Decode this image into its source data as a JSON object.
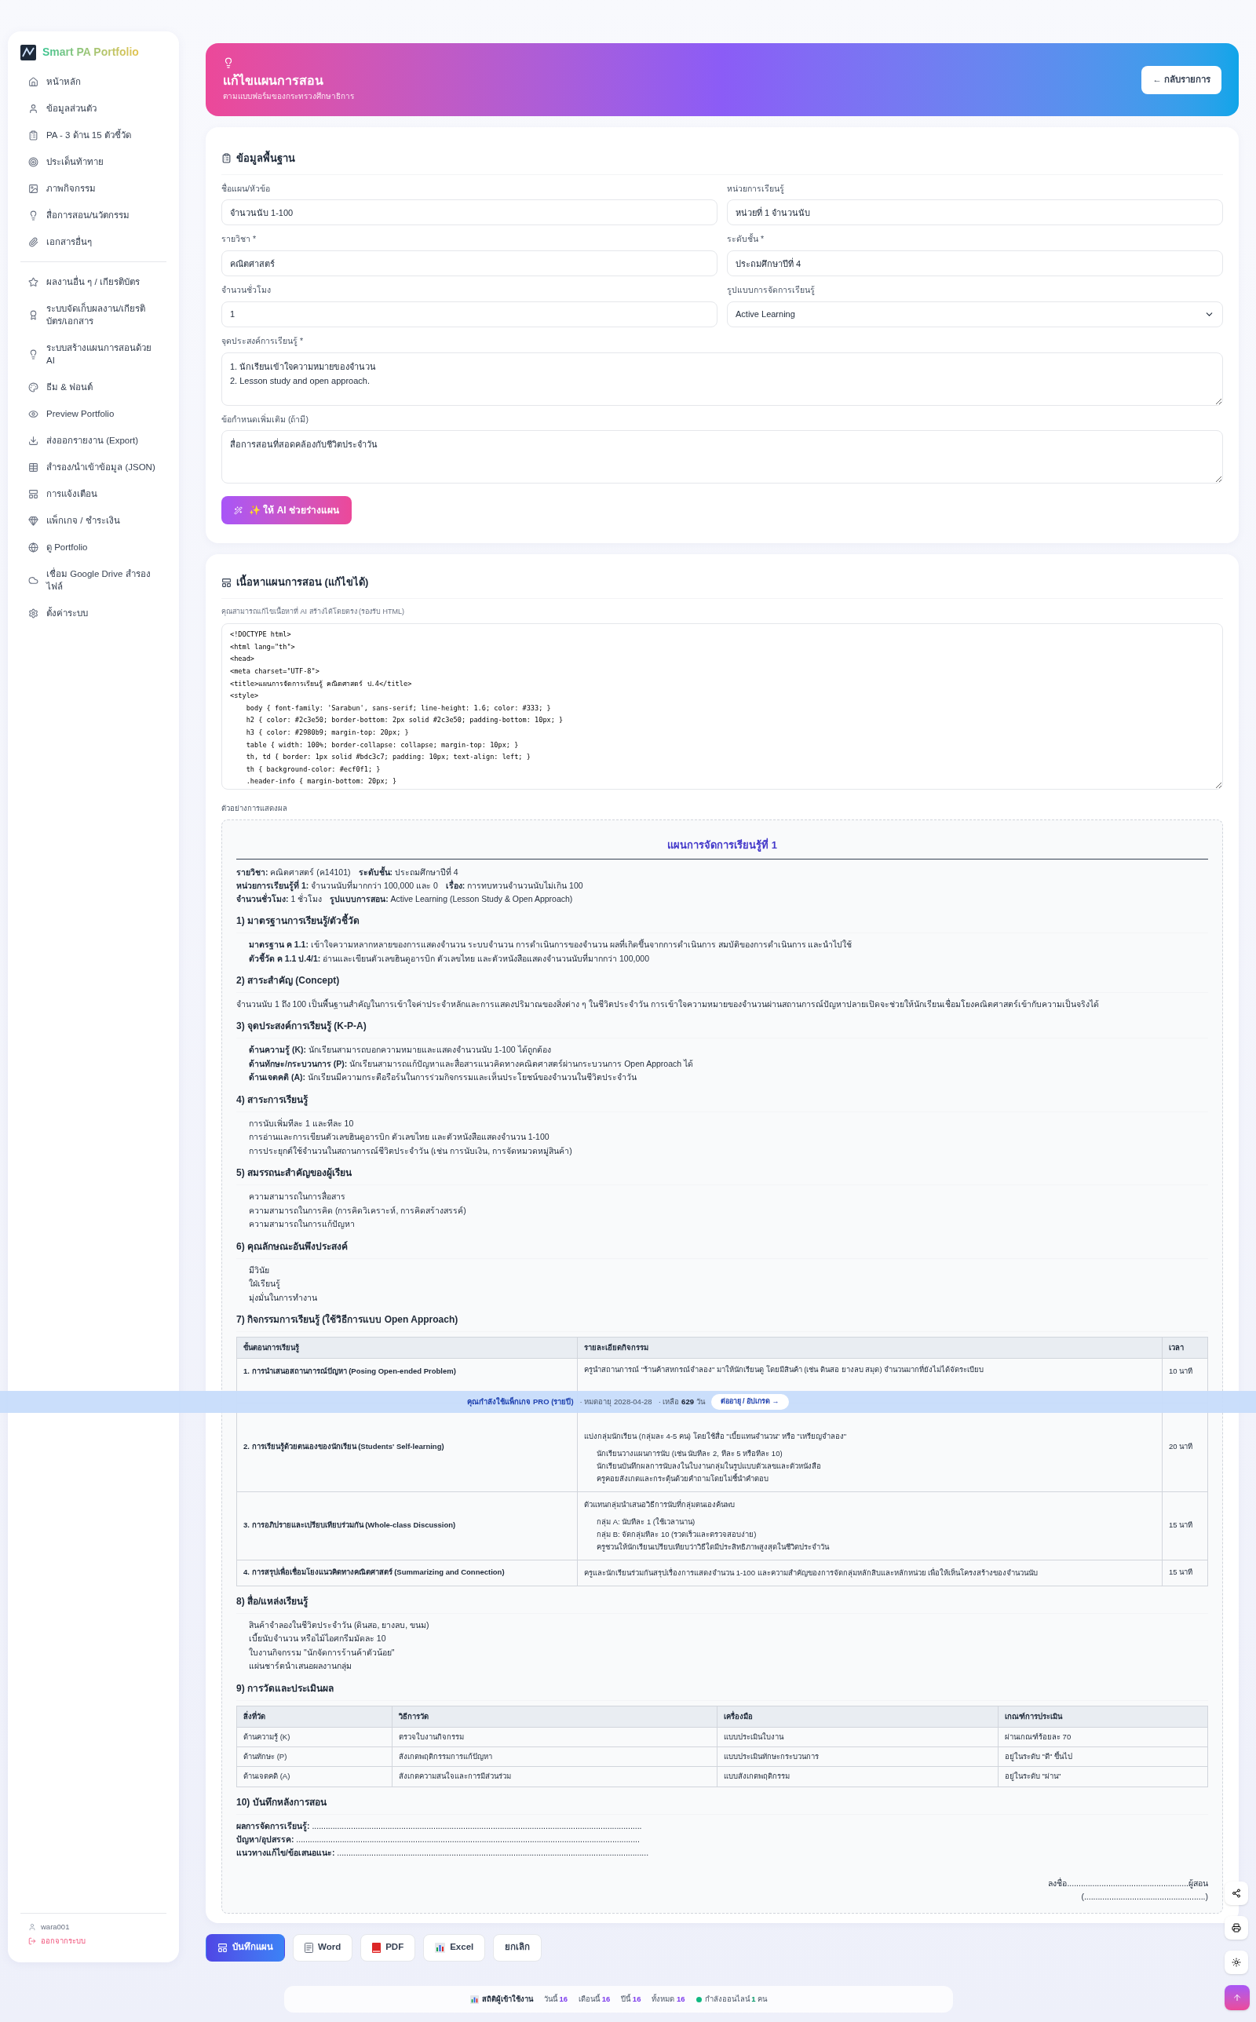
{
  "sidebar": {
    "brand": "Smart PA Portfolio",
    "groups": [
      [
        "หน้าหลัก",
        "ข้อมูลส่วนตัว",
        "PA - 3 ด้าน 15 ตัวชี้วัด",
        "ประเด็นท้าทาย",
        "ภาพกิจกรรม",
        "สื่อการสอน/นวัตกรรม",
        "เอกสารอื่นๆ"
      ],
      [
        "ผลงานอื่น ๆ / เกียรติบัตร",
        "ระบบจัดเก็บผลงาน/เกียรติบัตร/เอกสาร",
        "ระบบสร้างแผนการสอนด้วย AI",
        "ธีม & ฟอนต์",
        "Preview Portfolio",
        "ส่งออกรายงาน (Export)",
        "สำรอง/นำเข้าข้อมูล (JSON)",
        "การแจ้งเตือน",
        "แพ็กเกจ / ชำระเงิน",
        "ดู Portfolio",
        "เชื่อม Google Drive สำรองไฟล์",
        "ตั้งค่าระบบ"
      ]
    ],
    "user": "wara001",
    "logout": "ออกจากระบบ"
  },
  "header": {
    "title": "แก้ไขแผนการสอน",
    "subtitle": "ตามแบบฟอร์มของกระทรวงศึกษาธิการ",
    "back_button": "← กลับรายการ"
  },
  "basic_info": {
    "title": "ข้อมูลพื้นฐาน",
    "fields": [
      {
        "kind": "input",
        "label": "ชื่อแผน/หัวข้อ",
        "value": "จำนวนนับ 1-100"
      },
      {
        "kind": "input",
        "label": "หน่วยการเรียนรู้",
        "value": "หน่วยที่ 1 จำนวนนับ"
      },
      {
        "kind": "input",
        "label": "รายวิชา *",
        "value": "คณิตศาสตร์"
      },
      {
        "kind": "input",
        "label": "ระดับชั้น *",
        "value": "ประถมศึกษาปีที่ 4"
      },
      {
        "kind": "input",
        "label": "จำนวนชั่วโมง",
        "value": "1"
      },
      {
        "kind": "select",
        "label": "รูปแบบการจัดการเรียนรู้",
        "value": "Active Learning"
      },
      {
        "kind": "textarea",
        "label": "จุดประสงค์การเรียนรู้ *",
        "value": "1. นักเรียนเข้าใจความหมายของจำนวน\n2. Lesson study and open approach."
      },
      {
        "kind": "textarea",
        "label": "ข้อกำหนดเพิ่มเติม (ถ้ามี)",
        "value": "สื่อการสอนที่สอดคล้องกับชีวิตประจำวัน"
      }
    ],
    "ai_button": "✨ ให้ AI ช่วยร่างแผน"
  },
  "content": {
    "title": "เนื้อหาแผนการสอน (แก้ไขได้)",
    "hint": "คุณสามารถแก้ไขเนื้อหาที่ AI สร้างได้โดยตรง (รองรับ HTML)",
    "code_lines": [
      "<!DOCTYPE html>",
      "<html lang=\"th\">",
      "<head>",
      "<meta charset=\"UTF-8\">",
      "<title>แผนการจัดการเรียนรู้ คณิตศาสตร์ ป.4</title>",
      "<style>",
      "    body { font-family: 'Sarabun', sans-serif; line-height: 1.6; color: #333; }",
      "    h2 { color: #2c3e50; border-bottom: 2px solid #2c3e50; padding-bottom: 10px; }",
      "    h3 { color: #2980b9; margin-top: 20px; }",
      "    table { width: 100%; border-collapse: collapse; margin-top: 10px; }",
      "    th, td { border: 1px solid #bdc3c7; padding: 10px; text-align: left; }",
      "    th { background-color: #ecf0f1; }",
      "    .header-info { margin-bottom: 20px; }"
    ],
    "preview_label": "ตัวอย่างการแสดงผล",
    "preview": {
      "title": "แผนการจัดการเรียนรู้ที่ 1",
      "info_lines": [
        [
          {
            "label": "รายวิชา:",
            "value": "คณิตศาสตร์ (ค14101)"
          },
          {
            "label": "ระดับชั้น:",
            "value": "ประถมศึกษาปีที่ 4"
          }
        ],
        [
          {
            "label": "หน่วยการเรียนรู้ที่ 1:",
            "value": "จำนวนนับที่มากกว่า 100,000 และ 0"
          },
          {
            "label": "เรื่อง:",
            "value": "การทบทวนจำนวนนับไม่เกิน 100"
          }
        ],
        [
          {
            "label": "จำนวนชั่วโมง:",
            "value": "1 ชั่วโมง"
          },
          {
            "label": "รูปแบบการสอน:",
            "value": "Active Learning (Lesson Study & Open Approach)"
          }
        ]
      ],
      "sections": [
        {
          "kind": "list",
          "heading": "1) มาตรฐานการเรียนรู้/ตัวชี้วัด",
          "items": [
            "**มาตรฐาน ค 1.1:** เข้าใจความหลากหลายของการแสดงจำนวน ระบบจำนวน การดำเนินการของจำนวน ผลที่เกิดขึ้นจากการดำเนินการ สมบัติของการดำเนินการ และนำไปใช้",
            "**ตัวชี้วัด ค 1.1 ป.4/1:** อ่านและเขียนตัวเลขฮินดูอารบิก ตัวเลขไทย และตัวหนังสือแสดงจำนวนนับที่มากกว่า 100,000"
          ]
        },
        {
          "kind": "paragraph",
          "heading": "2) สาระสำคัญ (Concept)",
          "text": "จำนวนนับ 1 ถึง 100 เป็นพื้นฐานสำคัญในการเข้าใจค่าประจำหลักและการแสดงปริมาณของสิ่งต่าง ๆ ในชีวิตประจำวัน การเข้าใจความหมายของจำนวนผ่านสถานการณ์ปัญหาปลายเปิดจะช่วยให้นักเรียนเชื่อมโยงคณิตศาสตร์เข้ากับความเป็นจริงได้"
        },
        {
          "kind": "list",
          "heading": "3) จุดประสงค์การเรียนรู้ (K-P-A)",
          "items": [
            "**ด้านความรู้ (K):** นักเรียนสามารถบอกความหมายและแสดงจำนวนนับ 1-100 ได้ถูกต้อง",
            "**ด้านทักษะ/กระบวนการ (P):** นักเรียนสามารถแก้ปัญหาและสื่อสารแนวคิดทางคณิตศาสตร์ผ่านกระบวนการ Open Approach ได้",
            "**ด้านเจตคติ (A):** นักเรียนมีความกระตือรือร้นในการร่วมกิจกรรมและเห็นประโยชน์ของจำนวนในชีวิตประจำวัน"
          ]
        },
        {
          "kind": "list",
          "heading": "4) สาระการเรียนรู้",
          "items": [
            "การนับเพิ่มทีละ 1 และทีละ 10",
            "การอ่านและการเขียนตัวเลขฮินดูอารบิก ตัวเลขไทย และตัวหนังสือแสดงจำนวน 1-100",
            "การประยุกต์ใช้จำนวนในสถานการณ์ชีวิตประจำวัน (เช่น การนับเงิน, การจัดหมวดหมู่สินค้า)"
          ]
        },
        {
          "kind": "list",
          "heading": "5) สมรรถนะสำคัญของผู้เรียน",
          "items": [
            "ความสามารถในการสื่อสาร",
            "ความสามารถในการคิด (การคิดวิเคราะห์, การคิดสร้างสรรค์)",
            "ความสามารถในการแก้ปัญหา"
          ]
        },
        {
          "kind": "list",
          "heading": "6) คุณลักษณะอันพึงประสงค์",
          "items": [
            "มีวินัย",
            "ใฝ่เรียนรู้",
            "มุ่งมั่นในการทำงาน"
          ]
        },
        {
          "kind": "table",
          "heading": "7) กิจกรรมการเรียนรู้ (ใช้วิธีการแบบ Open Approach)",
          "columns": [
            "ขั้นตอนการเรียนรู้",
            "รายละเอียดกิจกรรม",
            "เวลา"
          ],
          "rows": [
            {
              "step": "1. การนำเสนอสถานการณ์ปัญหา (Posing Open-ended Problem)",
              "intro": "ครูนำสถานการณ์ \"ร้านค้าสหกรณ์จำลอง\" มาให้นักเรียนดู โดยมีสินค้า (เช่น ดินสอ ยางลบ สมุด) จำนวนมากที่ยังไม่ได้จัดระเบียบ",
              "points": [],
              "time": "10 นาที"
            },
            {
              "step": "2. การเรียนรู้ด้วยตนเองของนักเรียน (Students' Self-learning)",
              "intro": "แบ่งกลุ่มนักเรียน (กลุ่มละ 4-5 คน) โดยใช้สื่อ \"เบี้ยแทนจำนวน\" หรือ \"เหรียญจำลอง\"",
              "points": [
                "นักเรียนวางแผนการนับ (เช่น นับทีละ 2, ทีละ 5 หรือทีละ 10)",
                "นักเรียนบันทึกผลการนับลงในใบงานกลุ่มในรูปแบบตัวเลขและตัวหนังสือ",
                "ครูคอยสังเกตและกระตุ้นด้วยคำถามโดยไม่ชี้นำคำตอบ"
              ],
              "time": "20 นาที"
            },
            {
              "step": "3. การอภิปรายและเปรียบเทียบร่วมกัน (Whole-class Discussion)",
              "intro": "ตัวแทนกลุ่มนำเสนอวิธีการนับที่กลุ่มตนเองค้นพบ",
              "points": [
                "กลุ่ม A: นับทีละ 1 (ใช้เวลานาน)",
                "กลุ่ม B: จัดกลุ่มทีละ 10 (รวดเร็วและตรวจสอบง่าย)",
                "ครูชวนให้นักเรียนเปรียบเทียบว่าวิธีใดมีประสิทธิภาพสูงสุดในชีวิตประจำวัน"
              ],
              "time": "15 นาที"
            },
            {
              "step": "4. การสรุปเพื่อเชื่อมโยงแนวคิดทางคณิตศาสตร์ (Summarizing and Connection)",
              "intro": "ครูและนักเรียนร่วมกันสรุปเรื่องการแสดงจำนวน 1-100 และความสำคัญของการจัดกลุ่มหลักสิบและหลักหน่วย เพื่อให้เห็นโครงสร้างของจำนวนนับ",
              "points": [],
              "time": "15 นาที"
            }
          ]
        },
        {
          "kind": "list",
          "heading": "8) สื่อ/แหล่งเรียนรู้",
          "items": [
            "สินค้าจำลองในชีวิตประจำวัน (ดินสอ, ยางลบ, ขนม)",
            "เบี้ยนับจำนวน หรือไม้ไอศกรีมมัดละ 10",
            "ใบงานกิจกรรม \"นักจัดการร้านค้าตัวน้อย\"",
            "แผ่นชาร์ตนำเสนอผลงานกลุ่ม"
          ]
        },
        {
          "kind": "grid",
          "heading": "9) การวัดและประเมินผล",
          "columns": [
            "สิ่งที่วัด",
            "วิธีการวัด",
            "เครื่องมือ",
            "เกณฑ์การประเมิน"
          ],
          "rows": [
            [
              "ด้านความรู้ (K)",
              "ตรวจใบงานกิจกรรม",
              "แบบประเมินใบงาน",
              "ผ่านเกณฑ์ร้อยละ 70"
            ],
            [
              "ด้านทักษะ (P)",
              "สังเกตพฤติกรรมการแก้ปัญหา",
              "แบบประเมินทักษะกระบวนการ",
              "อยู่ในระดับ \"ดี\" ขึ้นไป"
            ],
            [
              "ด้านเจตคติ (A)",
              "สังเกตความสนใจและการมีส่วนร่วม",
              "แบบสังเกตพฤติกรรม",
              "อยู่ในระดับ \"ผ่าน\""
            ]
          ]
        },
        {
          "kind": "notes",
          "heading": "10) บันทึกหลังการสอน",
          "items": [
            {
              "label": "ผลการจัดการเรียนรู้:",
              "dots": "................................................................................................................................................"
            },
            {
              "label": "ปัญหา/อุปสรรค:",
              "dots": "......................................................................................................................................................"
            },
            {
              "label": "แนวทางแก้ไข/ข้อเสนอแนะ:",
              "dots": "........................................................................................................................................"
            }
          ],
          "signature": [
            "ลงชื่อ.....................................................ผู้สอน",
            "(.....................................................)"
          ]
        }
      ]
    }
  },
  "subscription_bar": {
    "text": "คุณกำลังใช้แพ็กเกจ PRO (รายปี)",
    "expiry": "· หมดอายุ 2028-04-28",
    "remaining_label": "· เหลือ",
    "remaining_value": "629",
    "remaining_unit": "วัน",
    "button": "ต่ออายุ / อัปเกรด →"
  },
  "actions": [
    {
      "kind": "primary",
      "label": "บันทึกแผน"
    },
    {
      "kind": "word",
      "label": "Word"
    },
    {
      "kind": "pdf",
      "label": "PDF"
    },
    {
      "kind": "excel",
      "label": "Excel"
    },
    {
      "kind": "plain",
      "label": "ยกเลิก"
    }
  ],
  "stats": {
    "title": "สถิติผู้เข้าใช้งาน",
    "items": [
      {
        "label": "วันนี้",
        "value": "16"
      },
      {
        "label": "เดือนนี้",
        "value": "16"
      },
      {
        "label": "ปีนี้",
        "value": "16"
      },
      {
        "label": "ทั้งหมด",
        "value": "16"
      }
    ],
    "online": {
      "label": "กำลังออนไลน์",
      "value": "1",
      "unit": "คน"
    }
  }
}
